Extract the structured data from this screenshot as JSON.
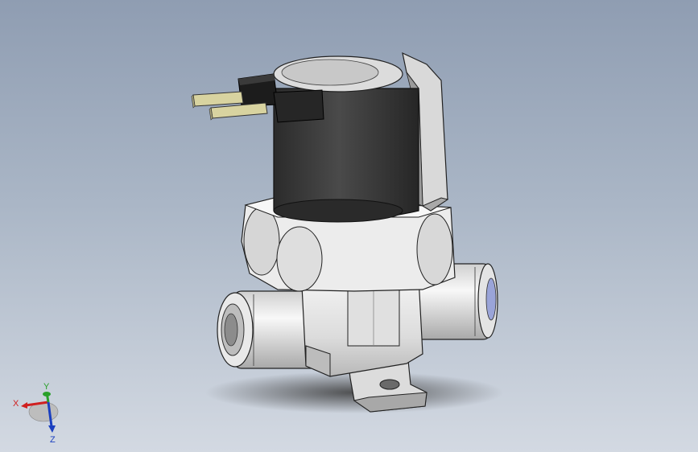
{
  "viewport": {
    "background_top": "#8f9db2",
    "background_bottom": "#d3d9e2"
  },
  "model": {
    "description_icon": "solenoid-valve-3d-model",
    "coil_color": "#3a3a3a",
    "body_color": "#e6e6e6",
    "terminal_color": "#d8d3a0"
  },
  "triad": {
    "x_label": "X",
    "y_label": "Y",
    "z_label": "Z",
    "x_color": "#d02020",
    "y_color": "#2aa02a",
    "z_color": "#1a3fc0"
  }
}
